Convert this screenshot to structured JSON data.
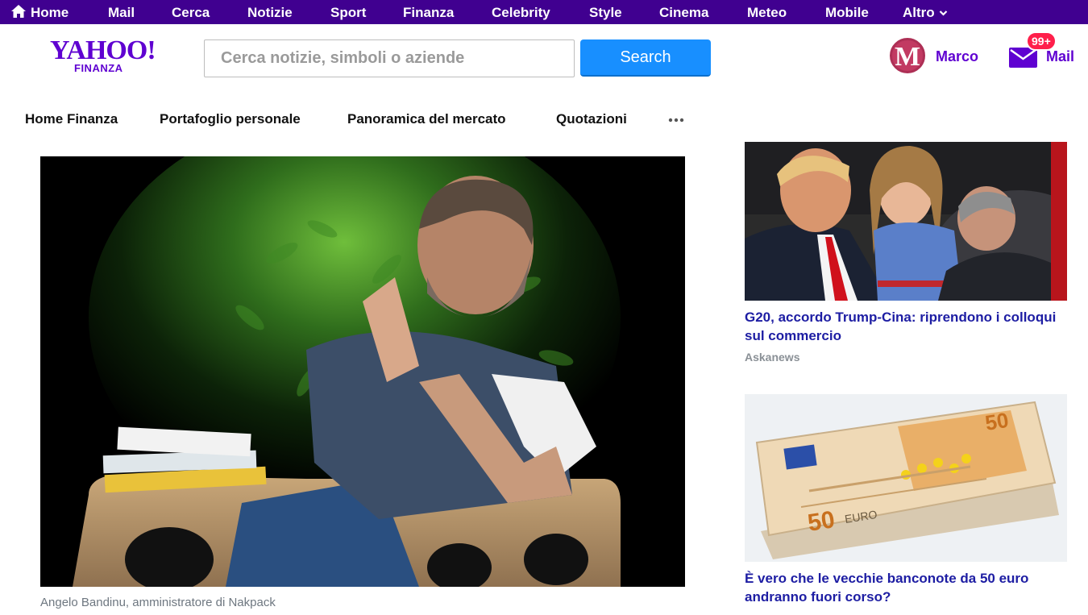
{
  "topnav": {
    "items": [
      "Home",
      "Mail",
      "Cerca",
      "Notizie",
      "Sport",
      "Finanza",
      "Celebrity",
      "Style",
      "Cinema",
      "Meteo",
      "Mobile",
      "Altro"
    ]
  },
  "logo": {
    "brand": "YAHOO!",
    "sub": "FINANZA"
  },
  "search": {
    "placeholder": "Cerca notizie, simboli o aziende",
    "button_label": "Search"
  },
  "user": {
    "initial": "M",
    "name": "Marco"
  },
  "mail": {
    "label": "Mail",
    "badge": "99+"
  },
  "subnav": {
    "items": [
      "Home Finanza",
      "Portafoglio personale",
      "Panoramica del mercato",
      "Quotazioni"
    ]
  },
  "article": {
    "caption": "Angelo Bandinu, amministratore di Nakpack"
  },
  "sidebar": {
    "stories": [
      {
        "title": "G20, accordo Trump-Cina: riprendono i colloqui sul commercio",
        "source": "Askanews"
      },
      {
        "title": "È vero che le vecchie banconote da 50 euro andranno fuori corso?",
        "source": ""
      }
    ]
  },
  "colors": {
    "nav_bg": "#400090",
    "brand": "#5f01d1",
    "search_button": "#188fff",
    "badge": "#ff1f4b",
    "link": "#1d1da3"
  },
  "icons": [
    "home-icon",
    "chevron-down-icon",
    "mail-icon",
    "more-icon"
  ]
}
